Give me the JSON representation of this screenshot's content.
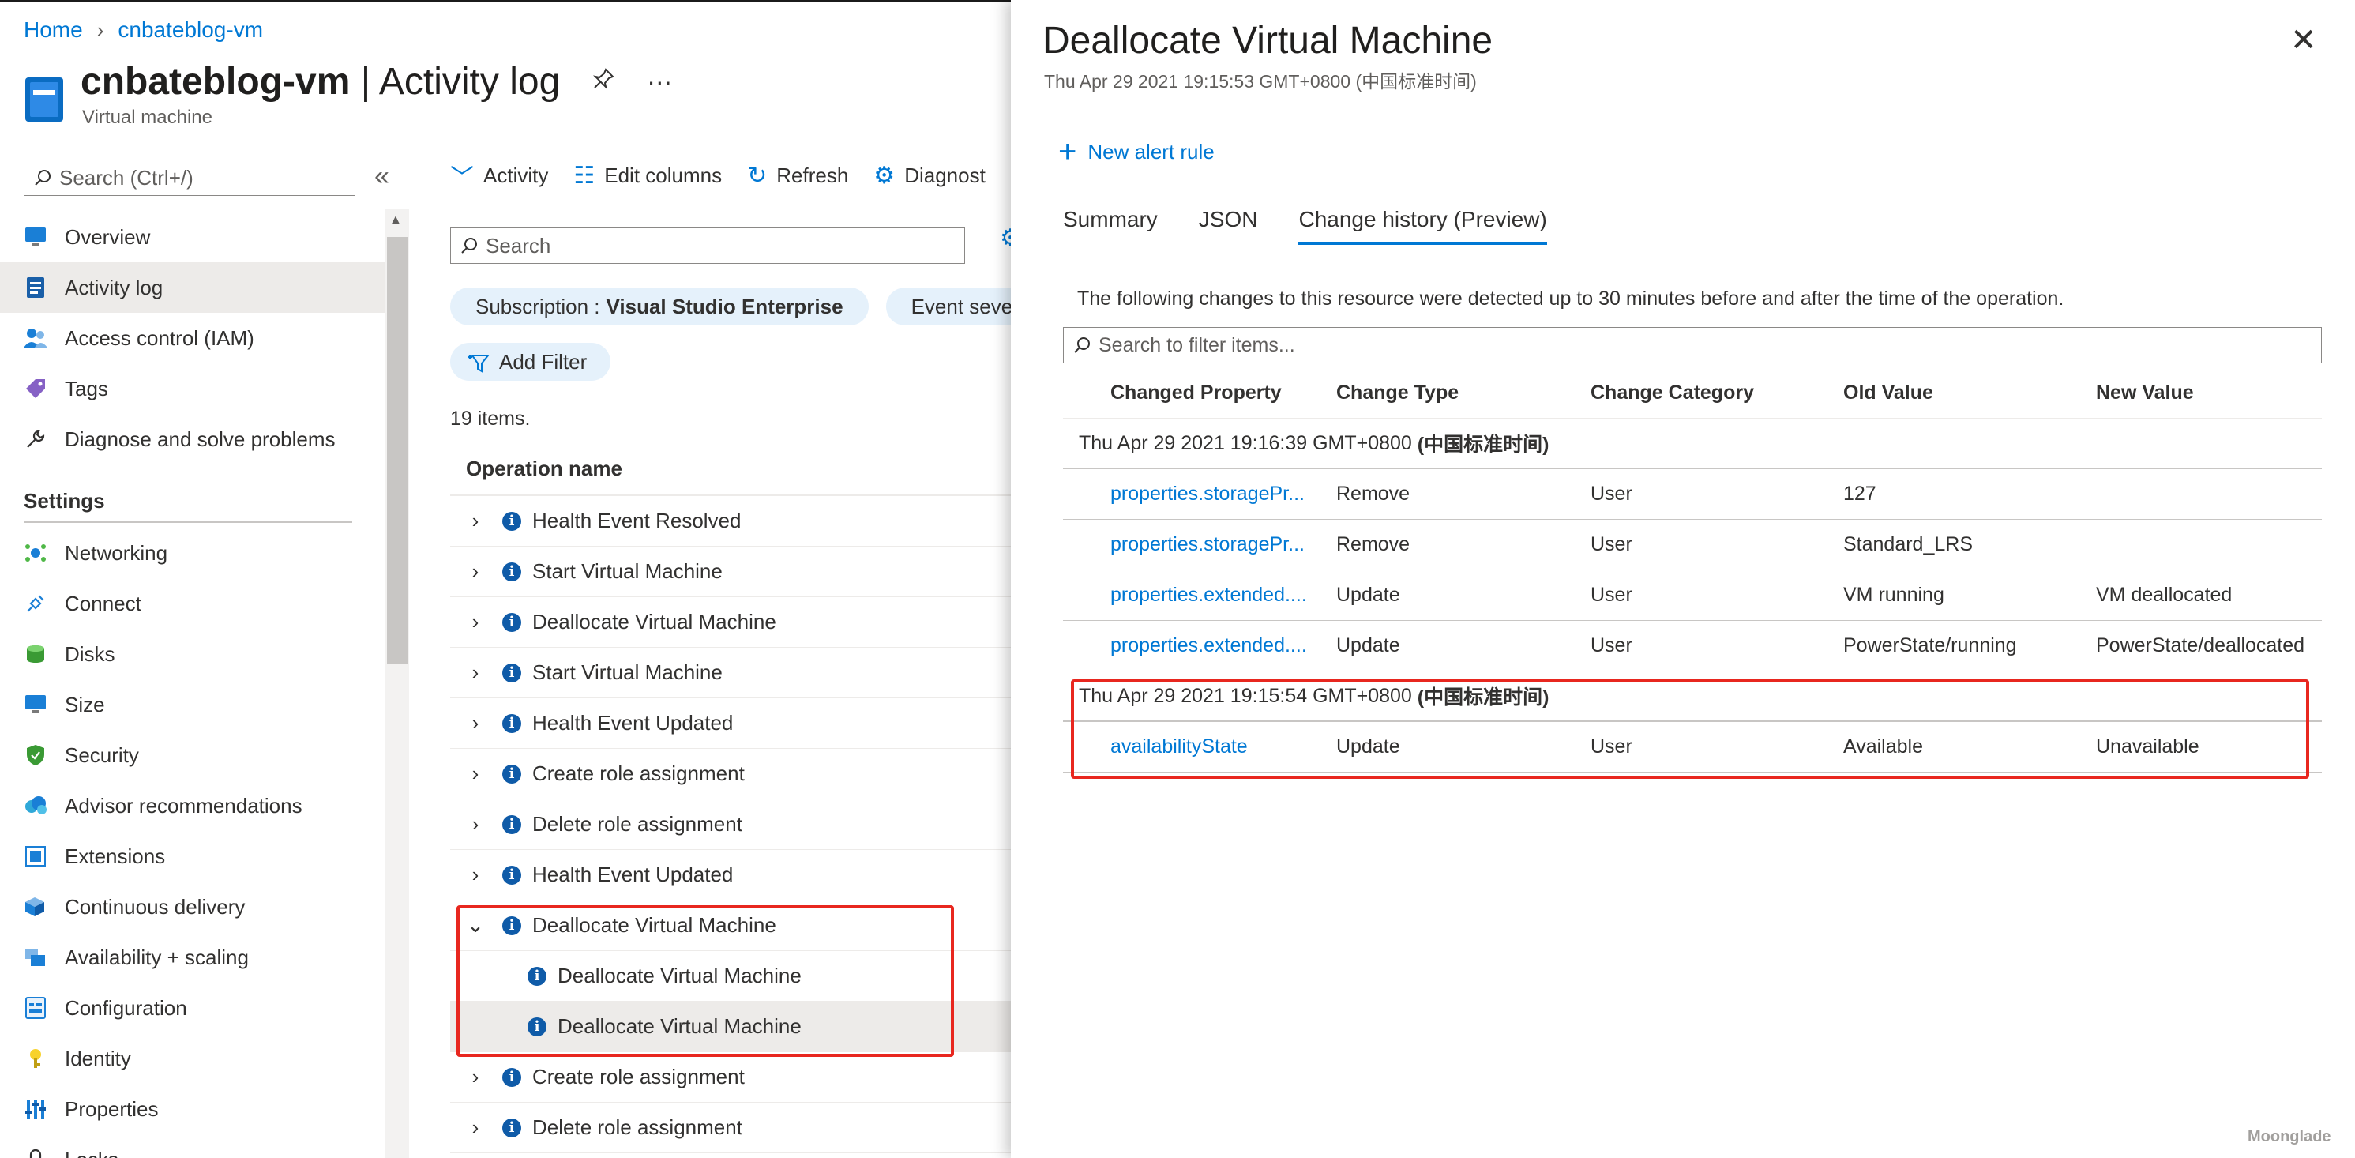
{
  "breadcrumb": [
    "Home",
    "cnbateblog-vm"
  ],
  "header": {
    "resource": "cnbateblog-vm",
    "blade": "Activity log",
    "separator": "|",
    "subtitle": "Virtual machine"
  },
  "side_search_placeholder": "Search (Ctrl+/)",
  "sidebar": {
    "items": [
      {
        "label": "Overview",
        "icon": "monitor-icon",
        "active": false
      },
      {
        "label": "Activity log",
        "icon": "activity-log-icon",
        "active": true
      },
      {
        "label": "Access control (IAM)",
        "icon": "people-icon",
        "active": false
      },
      {
        "label": "Tags",
        "icon": "tag-icon",
        "active": false
      },
      {
        "label": "Diagnose and solve problems",
        "icon": "wrench-icon",
        "active": false
      }
    ],
    "settings_label": "Settings",
    "settings_items": [
      {
        "label": "Networking",
        "icon": "network-icon"
      },
      {
        "label": "Connect",
        "icon": "plug-icon"
      },
      {
        "label": "Disks",
        "icon": "disk-icon"
      },
      {
        "label": "Size",
        "icon": "size-icon"
      },
      {
        "label": "Security",
        "icon": "shield-icon"
      },
      {
        "label": "Advisor recommendations",
        "icon": "advisor-icon"
      },
      {
        "label": "Extensions",
        "icon": "extension-icon"
      },
      {
        "label": "Continuous delivery",
        "icon": "delivery-icon"
      },
      {
        "label": "Availability + scaling",
        "icon": "availability-icon"
      },
      {
        "label": "Configuration",
        "icon": "configuration-icon"
      },
      {
        "label": "Identity",
        "icon": "identity-icon"
      },
      {
        "label": "Properties",
        "icon": "properties-icon"
      },
      {
        "label": "Locks",
        "icon": "lock-icon"
      }
    ]
  },
  "toolbar": {
    "activity": "Activity",
    "edit_columns": "Edit columns",
    "refresh": "Refresh",
    "diagnostics": "Diagnost"
  },
  "main_search_placeholder": "Search",
  "filters": {
    "subscription_label": "Subscription :",
    "subscription_value": "Visual Studio Enterprise",
    "event_severity": "Event sever",
    "add_filter": "Add Filter"
  },
  "items_count": "19 items.",
  "operation_header": "Operation name",
  "operations": [
    {
      "name": "Health Event Resolved",
      "kind": "collapsed"
    },
    {
      "name": "Start Virtual Machine",
      "kind": "collapsed"
    },
    {
      "name": "Deallocate Virtual Machine",
      "kind": "collapsed"
    },
    {
      "name": "Start Virtual Machine",
      "kind": "collapsed"
    },
    {
      "name": "Health Event Updated",
      "kind": "collapsed"
    },
    {
      "name": "Create role assignment",
      "kind": "collapsed"
    },
    {
      "name": "Delete role assignment",
      "kind": "collapsed"
    },
    {
      "name": "Health Event Updated",
      "kind": "collapsed"
    },
    {
      "name": "Deallocate Virtual Machine",
      "kind": "expanded"
    },
    {
      "name": "Deallocate Virtual Machine",
      "kind": "child"
    },
    {
      "name": "Deallocate Virtual Machine",
      "kind": "child-selected"
    },
    {
      "name": "Create role assignment",
      "kind": "collapsed"
    },
    {
      "name": "Delete role assignment",
      "kind": "collapsed"
    }
  ],
  "panel": {
    "title": "Deallocate Virtual Machine",
    "timestamp": "Thu Apr 29 2021 19:15:53 GMT+0800 (中国标准时间)",
    "new_alert_rule": "New alert rule",
    "tabs": [
      {
        "label": "Summary",
        "active": false
      },
      {
        "label": "JSON",
        "active": false
      },
      {
        "label": "Change history (Preview)",
        "active": true
      }
    ],
    "description": "The following changes to this resource were detected up to 30 minutes before and after the time of the operation.",
    "filter_placeholder": "Search to filter items...",
    "columns": [
      "Changed Property",
      "Change Type",
      "Change Category",
      "Old Value",
      "New Value"
    ],
    "groups": [
      {
        "date": "Thu Apr 29 2021 19:16:39 GMT+0800",
        "tz": "(中国标准时间)",
        "rows": [
          [
            "properties.storagePr...",
            "Remove",
            "User",
            "127",
            ""
          ],
          [
            "properties.storagePr...",
            "Remove",
            "User",
            "Standard_LRS",
            ""
          ],
          [
            "properties.extended....",
            "Update",
            "User",
            "VM running",
            "VM deallocated"
          ],
          [
            "properties.extended....",
            "Update",
            "User",
            "PowerState/running",
            "PowerState/deallocated"
          ]
        ]
      },
      {
        "date": "Thu Apr 29 2021 19:15:54 GMT+0800",
        "tz": "(中国标准时间)",
        "rows": [
          [
            "availabilityState",
            "Update",
            "User",
            "Available",
            "Unavailable"
          ]
        ]
      }
    ]
  },
  "watermark": "Moonglade",
  "colors": {
    "accent": "#0078d4",
    "highlight": "#e8271f",
    "selected_bg": "#edebe9",
    "pill_bg": "#e5f1fb"
  }
}
